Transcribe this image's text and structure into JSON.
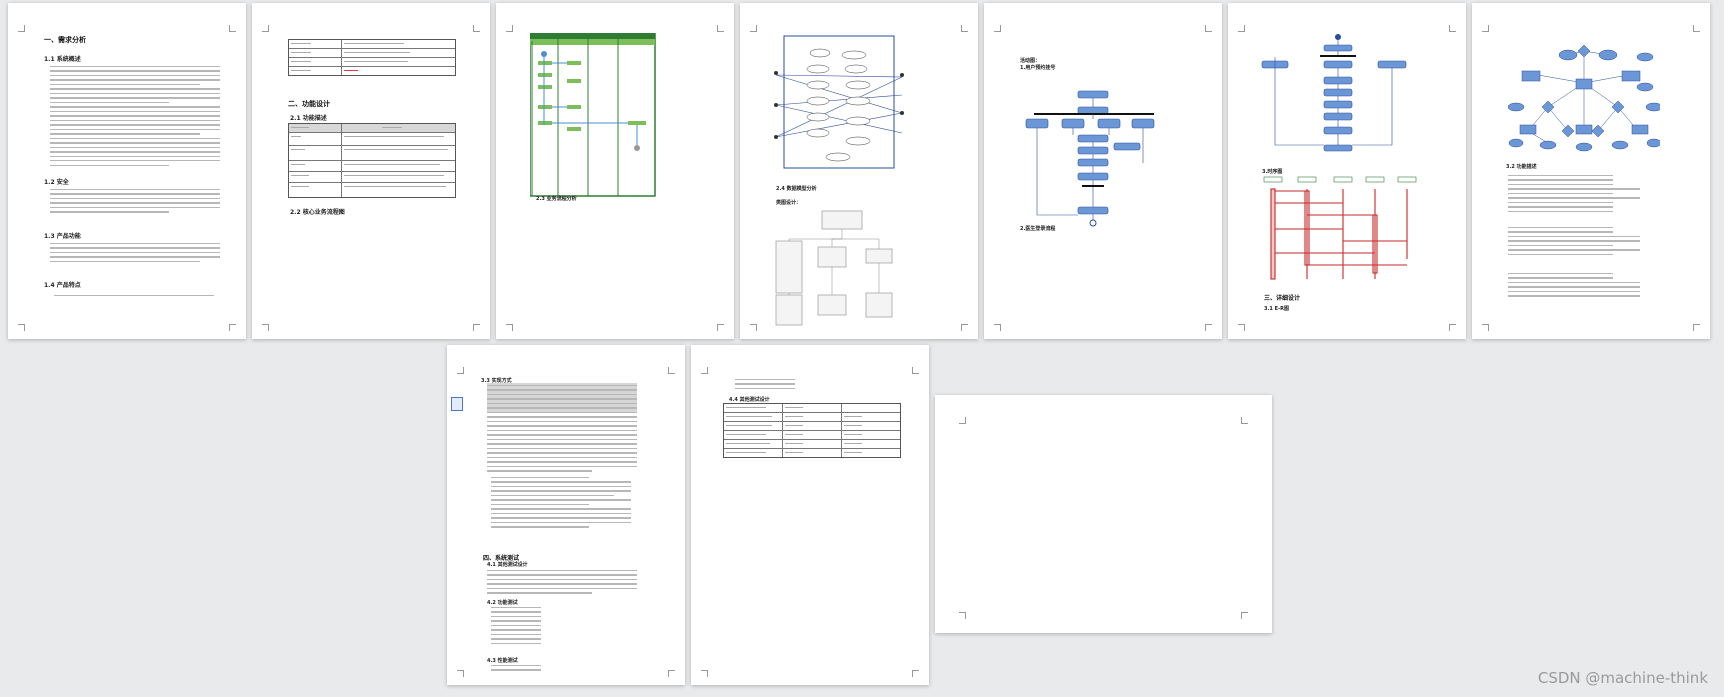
{
  "watermark": "CSDN @machine-think",
  "pages": {
    "p1": {
      "heading": "一、需求分析",
      "s1": "1.1 系统概述",
      "s2": "1.2 安全",
      "s3": "1.3 产品功能",
      "s4": "1.4 产品特点"
    },
    "p2": {
      "heading": "二、功能设计",
      "s1": "2.1 功能描述",
      "s2": "2.2 核心业务流程图"
    },
    "p3": {
      "caption": "2.3 业务流程分析"
    },
    "p4": {
      "caption": "2.4 数据模型分析",
      "sub": "类图设计："
    },
    "p5": {
      "title": "活动图：",
      "sub": "1.用户预约挂号",
      "caption": "2.医生登录流程"
    },
    "p6": {
      "caption": "3.时序图",
      "h3": "三、详细设计",
      "h3s": "3.1 E-R图"
    },
    "p7": {
      "caption": "3.2 功能描述"
    },
    "p8": {
      "heading": "3.3 实现方式"
    },
    "p9": {
      "heading": "4.4 其他测试设计"
    },
    "p8b": {
      "heading": "四、系统测试",
      "s1": "4.1 其他测试设计",
      "s2": "4.2 功能测试",
      "s3": "4.3 性能测试"
    }
  }
}
